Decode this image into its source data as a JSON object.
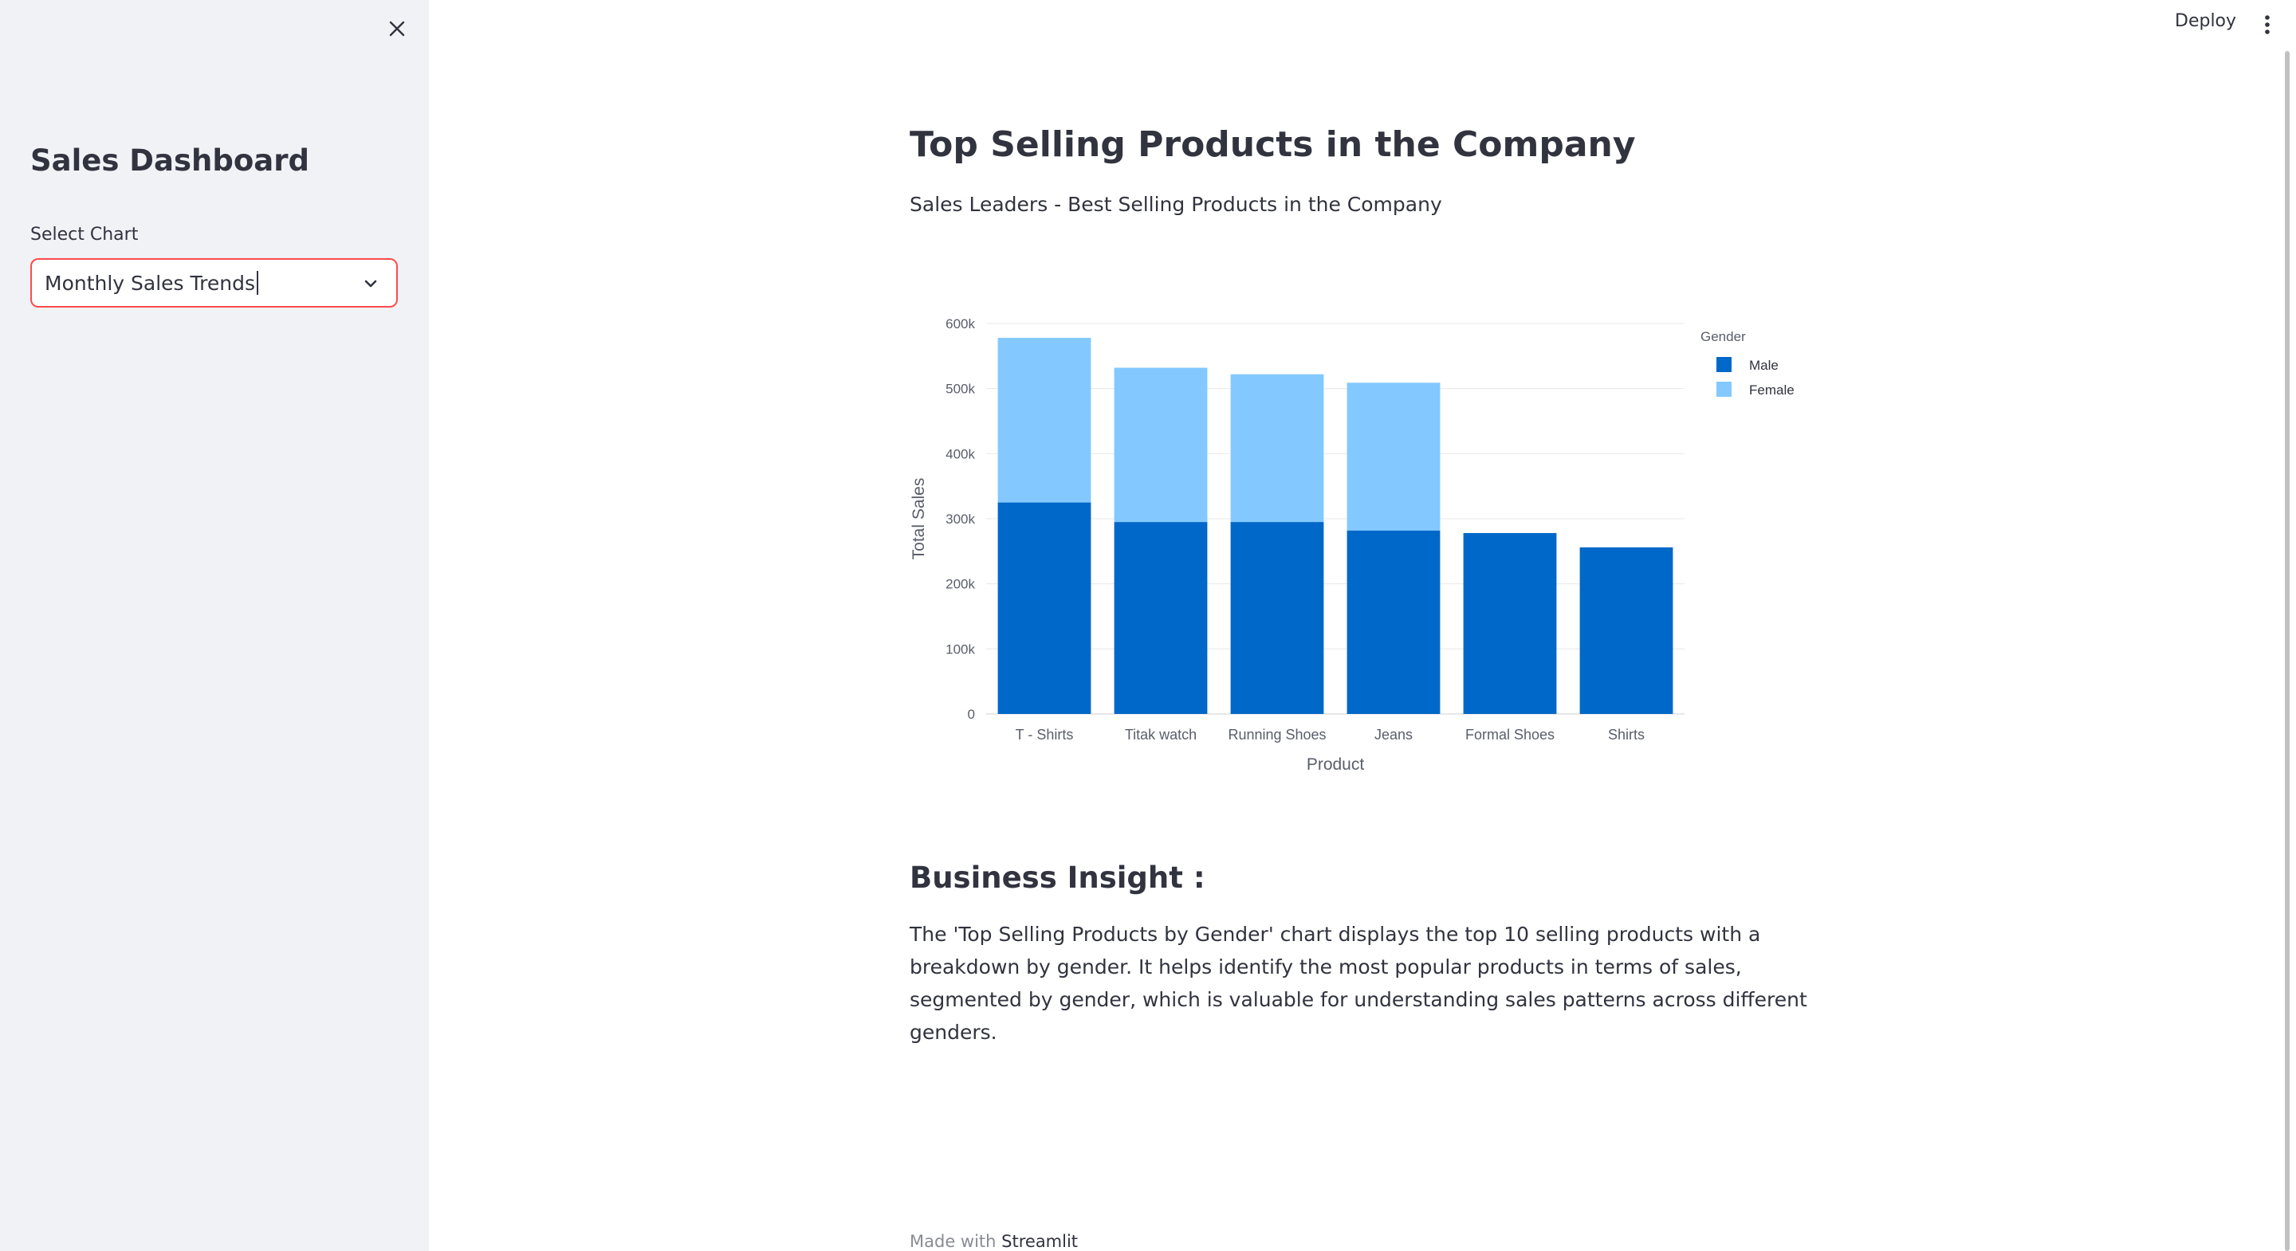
{
  "sidebar": {
    "title": "Sales Dashboard",
    "select_label": "Select Chart",
    "select_value": "Monthly Sales Trends"
  },
  "header": {
    "deploy_label": "Deploy"
  },
  "main": {
    "title": "Top Selling Products in the Company",
    "subtitle": "Sales Leaders - Best Selling Products in the Company",
    "insight_title": "Business Insight :",
    "insight_text": "The 'Top Selling Products by Gender' chart displays the top 10 selling products with a breakdown by gender. It helps identify the most popular products in terms of sales, segmented by gender, which is valuable for understanding sales patterns across different genders."
  },
  "footer": {
    "prefix": "Made with",
    "brand": "Streamlit"
  },
  "colors": {
    "male": "#0068c9",
    "female": "#83c9ff",
    "accent": "#ff4b4b"
  },
  "chart_data": {
    "type": "bar",
    "stacked": true,
    "categories": [
      "T - Shirts",
      "Titak watch",
      "Running Shoes",
      "Jeans",
      "Formal Shoes",
      "Shirts"
    ],
    "series": [
      {
        "name": "Male",
        "values": [
          325000,
          295000,
          295000,
          282000,
          278000,
          256000
        ]
      },
      {
        "name": "Female",
        "values": [
          253000,
          237000,
          227000,
          227000,
          0,
          0
        ]
      }
    ],
    "xlabel": "Product",
    "ylabel": "Total Sales",
    "legend_title": "Gender",
    "legend_position": "top-right",
    "ylim": [
      0,
      600000
    ],
    "yticks": [
      0,
      100000,
      200000,
      300000,
      400000,
      500000,
      600000
    ],
    "ytick_labels": [
      "0",
      "100k",
      "200k",
      "300k",
      "400k",
      "500k",
      "600k"
    ],
    "grid": true
  }
}
